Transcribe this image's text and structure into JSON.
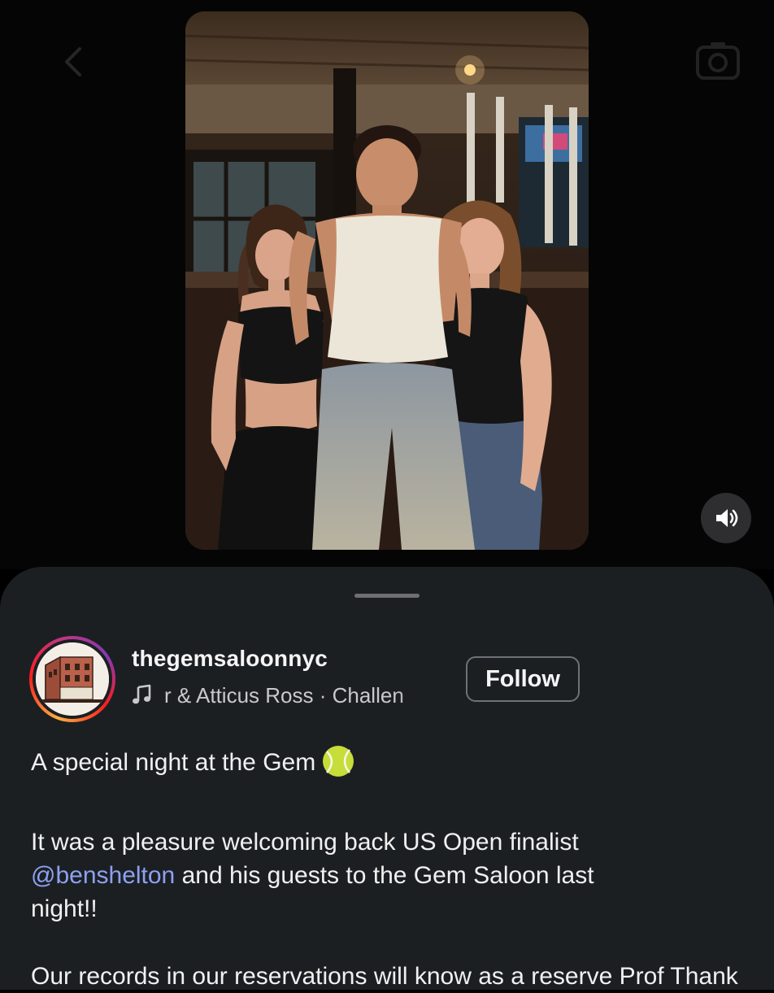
{
  "header": {
    "back_icon": "chevron-left-icon",
    "camera_icon": "camera-icon"
  },
  "post": {
    "image_alt": "Three people posing inside a saloon-style bar"
  },
  "controls": {
    "sound_icon": "speaker-icon"
  },
  "account": {
    "username": "thegemsaloonnyc",
    "audio": "r & Atticus Ross · Challen",
    "follow_label": "Follow"
  },
  "caption": {
    "title": "A special night at the Gem",
    "title_emoji": "tennis-ball",
    "line1": "It was a pleasure welcoming back US Open finalist",
    "mention": "@benshelton",
    "line2_rest": " and his guests to the Gem Saloon last",
    "line3": "night!!",
    "line4_partial": "Our records in our reservations will know as a reserve Prof Thank"
  },
  "colors": {
    "sheet_bg": "#1c1f22",
    "mention": "#8da1f0",
    "follow_border": "#6e7175"
  }
}
